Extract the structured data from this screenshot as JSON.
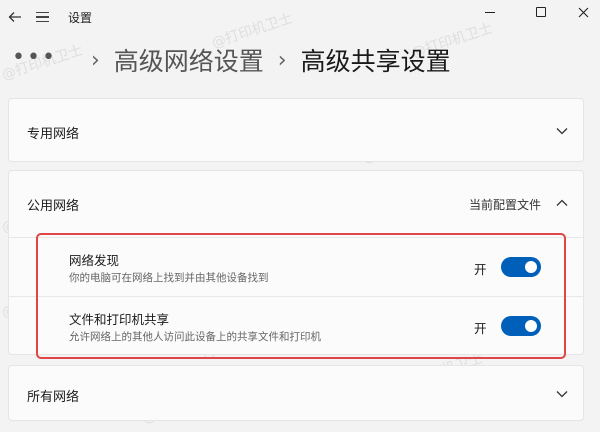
{
  "window": {
    "title": "设置"
  },
  "breadcrumb": {
    "more": "•••",
    "items": [
      "高级网络设置",
      "高级共享设置"
    ]
  },
  "sections": {
    "private": {
      "label": "专用网络",
      "expanded": false
    },
    "public": {
      "label": "公用网络",
      "profile_tag": "当前配置文件",
      "expanded": true,
      "settings": [
        {
          "title": "网络发现",
          "description": "你的电脑可在网络上找到并由其他设备找到",
          "state_label": "开",
          "on": true
        },
        {
          "title": "文件和打印机共享",
          "description": "允许网络上的其他人访问此设备上的共享文件和打印机",
          "state_label": "开",
          "on": true
        }
      ]
    },
    "all": {
      "label": "所有网络",
      "expanded": false
    }
  },
  "watermark": "@打印机卫士",
  "colors": {
    "accent": "#005fb8",
    "highlight": "#e04646",
    "background": "#f3f3f3",
    "card": "#fbfbfb"
  },
  "icons": {
    "back": "back-arrow-icon",
    "menu": "hamburger-menu-icon",
    "collapse": "chevron-down-icon",
    "expand": "chevron-up-icon"
  }
}
